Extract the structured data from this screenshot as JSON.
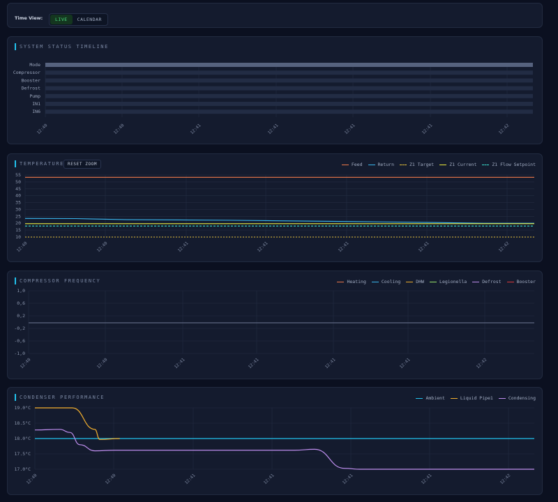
{
  "timeview": {
    "label": "Time View:",
    "options": [
      "LIVE",
      "CALENDAR"
    ],
    "selected": "LIVE"
  },
  "panels": {
    "status": {
      "title": "SYSTEM STATUS TIMELINE"
    },
    "temps": {
      "title": "TEMPERATURES",
      "reset_label": "RESET ZOOM"
    },
    "freq": {
      "title": "COMPRESSOR FREQUENCY"
    },
    "cond": {
      "title": "CONDENSER PERFORMANCE"
    }
  },
  "colors": {
    "accent": "#22c3ee",
    "feed": "#f07a4a",
    "return": "#3ab8f0",
    "z1_target": "#e7c23a",
    "z1_current": "#eaea3a",
    "z1_flow": "#3ae0d0",
    "heating": "#f07a4a",
    "cooling": "#3ab8f0",
    "dhw": "#f2b02c",
    "legionella": "#9be86a",
    "defrost": "#c08ff0",
    "booster": "#e03a3a",
    "ambient": "#22c3ee",
    "liquid_pipe": "#f5b12e",
    "condensing": "#c08ff0"
  },
  "chart_data": [
    {
      "type": "timeline",
      "title": "SYSTEM STATUS TIMELINE",
      "rows": [
        "Mode",
        "Compressor",
        "Booster",
        "Defrost",
        "Pump",
        "IN1",
        "IN6"
      ],
      "x_ticks": [
        "12:40",
        "12:40",
        "12:41",
        "12:41",
        "12:41",
        "12:41",
        "12:42"
      ]
    },
    {
      "type": "line",
      "title": "TEMPERATURES",
      "ylim": [
        18,
        55
      ],
      "y_ticks": [
        "55",
        "50",
        "45",
        "40",
        "35",
        "30",
        "25",
        "20",
        "15",
        "10"
      ],
      "x_ticks": [
        "12:40",
        "12:40",
        "12:41",
        "12:41",
        "12:41",
        "12:41",
        "12:42"
      ],
      "x": [
        0,
        1,
        2,
        3,
        4,
        5,
        6,
        7,
        8,
        9,
        10
      ],
      "series": [
        {
          "name": "Feed",
          "values": [
            53.3,
            53.3,
            53.3,
            53.3,
            53.3,
            53.3,
            53.3,
            53.3,
            53.3,
            53.3,
            53.3
          ]
        },
        {
          "name": "Return",
          "values": [
            23.5,
            23.4,
            22.6,
            22.4,
            22.2,
            21.8,
            21.4,
            21.0,
            20.6,
            20.0,
            20.0
          ]
        },
        {
          "name": "Z1 Target",
          "values": [
            10.0,
            10.0,
            10.0,
            10.0,
            10.0,
            10.0,
            10.0,
            10.0,
            10.0,
            10.0,
            10.0
          ]
        },
        {
          "name": "Z1 Current",
          "values": [
            19.7,
            19.7,
            19.7,
            19.7,
            19.7,
            19.7,
            19.7,
            19.7,
            19.7,
            19.7,
            19.7
          ]
        },
        {
          "name": "Z1 Flow Setpoint",
          "values": [
            18.0,
            18.0,
            18.0,
            18.0,
            18.0,
            18.0,
            18.0,
            18.0,
            18.0,
            18.0,
            18.0
          ]
        }
      ]
    },
    {
      "type": "line",
      "title": "COMPRESSOR FREQUENCY",
      "ylim": [
        -1.0,
        1.0
      ],
      "y_ticks": [
        "1,0",
        "0,6",
        "0,2",
        "-0,2",
        "-0,6",
        "-1,0"
      ],
      "x_ticks": [
        "12:40",
        "12:40",
        "12:41",
        "12:41",
        "12:41",
        "12:41",
        "12:42"
      ],
      "x": [
        0,
        10
      ],
      "series": [
        {
          "name": "Heating",
          "values": [
            0,
            0
          ]
        },
        {
          "name": "Cooling",
          "values": [
            0,
            0
          ]
        },
        {
          "name": "DHW",
          "values": [
            0,
            0
          ]
        },
        {
          "name": "Legionella",
          "values": [
            0,
            0
          ]
        },
        {
          "name": "Defrost",
          "values": [
            0,
            0
          ]
        },
        {
          "name": "Booster",
          "values": [
            0,
            0
          ]
        }
      ]
    },
    {
      "type": "line",
      "title": "CONDENSER PERFORMANCE",
      "ylim": [
        16.95,
        19.05
      ],
      "y_ticks": [
        "19.0°C",
        "18.5°C",
        "18.0°C",
        "17.5°C",
        "17.0°C"
      ],
      "x_ticks": [
        "12:40",
        "12:40",
        "12:41",
        "12:41",
        "12:41",
        "12:41",
        "12:42"
      ],
      "series": [
        {
          "name": "Ambient",
          "points": [
            [
              0,
              18.0
            ],
            [
              1,
              18.0
            ]
          ]
        },
        {
          "name": "Liquid Pipe1",
          "points": [
            [
              0,
              19.0
            ],
            [
              0.075,
              19.0
            ],
            [
              0.12,
              18.3
            ],
            [
              0.13,
              17.97
            ],
            [
              0.17,
              18.0
            ]
          ]
        },
        {
          "name": "Condensing",
          "points": [
            [
              0,
              18.28
            ],
            [
              0.05,
              18.3
            ],
            [
              0.07,
              18.2
            ],
            [
              0.09,
              17.8
            ],
            [
              0.12,
              17.6
            ],
            [
              0.16,
              17.62
            ],
            [
              0.52,
              17.62
            ],
            [
              0.56,
              17.65
            ],
            [
              0.62,
              17.03
            ],
            [
              0.65,
              17.0
            ],
            [
              1,
              17.0
            ]
          ]
        }
      ]
    }
  ]
}
